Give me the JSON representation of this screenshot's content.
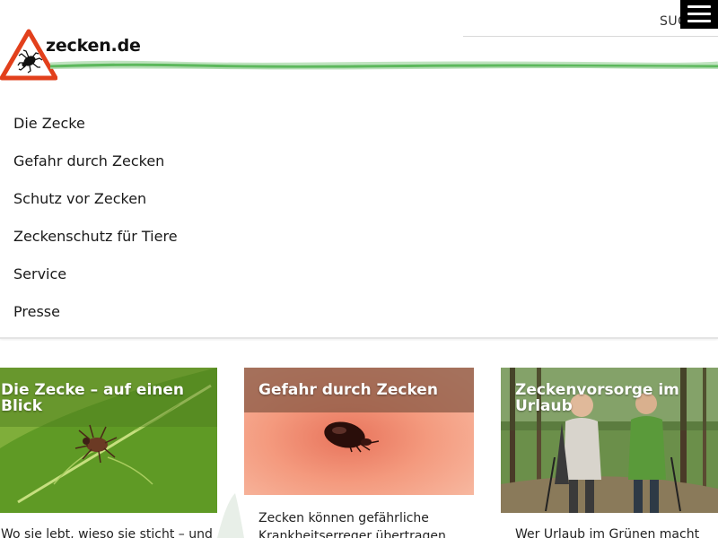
{
  "header": {
    "logo_text": "zecken.de",
    "search_label": "SUC"
  },
  "nav": {
    "items": [
      {
        "label": "Die Zecke"
      },
      {
        "label": "Gefahr durch Zecken"
      },
      {
        "label": "Schutz vor Zecken"
      },
      {
        "label": "Zeckenschutz für Tiere"
      },
      {
        "label": "Service"
      },
      {
        "label": "Presse"
      }
    ]
  },
  "cards": [
    {
      "title": "Die Zecke – auf einen Blick",
      "text": "Wo sie lebt, wieso sie sticht – und"
    },
    {
      "title": "Gefahr durch Zecken",
      "text": "Zecken können gefährliche Krankheitserreger übertragen"
    },
    {
      "title": "Zeckenvorsorge im Urlaub",
      "text": "Wer Urlaub im Grünen macht"
    }
  ],
  "colors": {
    "brand_green": "#5cb85c",
    "warning_red": "#e2401c",
    "menu_bg": "#000000"
  }
}
